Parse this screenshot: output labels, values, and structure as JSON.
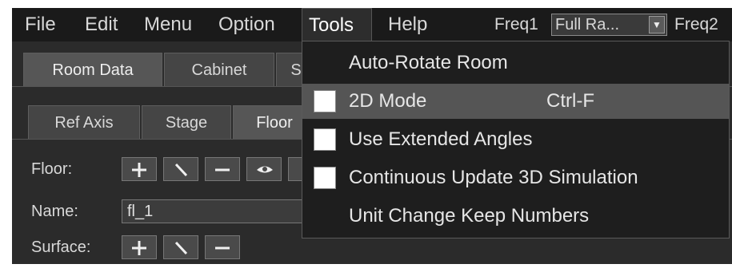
{
  "menubar": {
    "items": [
      {
        "label": "File"
      },
      {
        "label": "Edit"
      },
      {
        "label": "Menu"
      },
      {
        "label": "Option"
      },
      {
        "label": "Tools"
      },
      {
        "label": "Help"
      }
    ],
    "freq1_label": "Freq1",
    "freq1_value": "Full Ra...",
    "freq2_label": "Freq2"
  },
  "tabs_top": [
    {
      "label": "Room Data"
    },
    {
      "label": "Cabinet"
    },
    {
      "label": "S"
    }
  ],
  "tabs_sub": [
    {
      "label": "Ref Axis"
    },
    {
      "label": "Stage"
    },
    {
      "label": "Floor"
    }
  ],
  "form": {
    "floor_label": "Floor:",
    "name_label": "Name:",
    "name_value": "fl_1",
    "surface_label": "Surface:"
  },
  "tools_menu": {
    "items": [
      {
        "label": "Auto-Rotate Room",
        "checkable": false
      },
      {
        "label": "2D Mode",
        "shortcut": "Ctrl-F",
        "checkable": true,
        "checked": false,
        "highlighted": true
      },
      {
        "label": "Use Extended Angles",
        "checkable": true,
        "checked": false
      },
      {
        "label": "Continuous Update 3D Simulation",
        "checkable": true,
        "checked": false
      },
      {
        "label": "Unit Change Keep Numbers",
        "checkable": false
      }
    ]
  },
  "colors": {
    "window_bg": "#2b2b2b",
    "menubar_bg": "#1a1a1a",
    "menu_bg": "#1e1e1e",
    "highlight": "#555555",
    "text": "#d8d8d8"
  }
}
